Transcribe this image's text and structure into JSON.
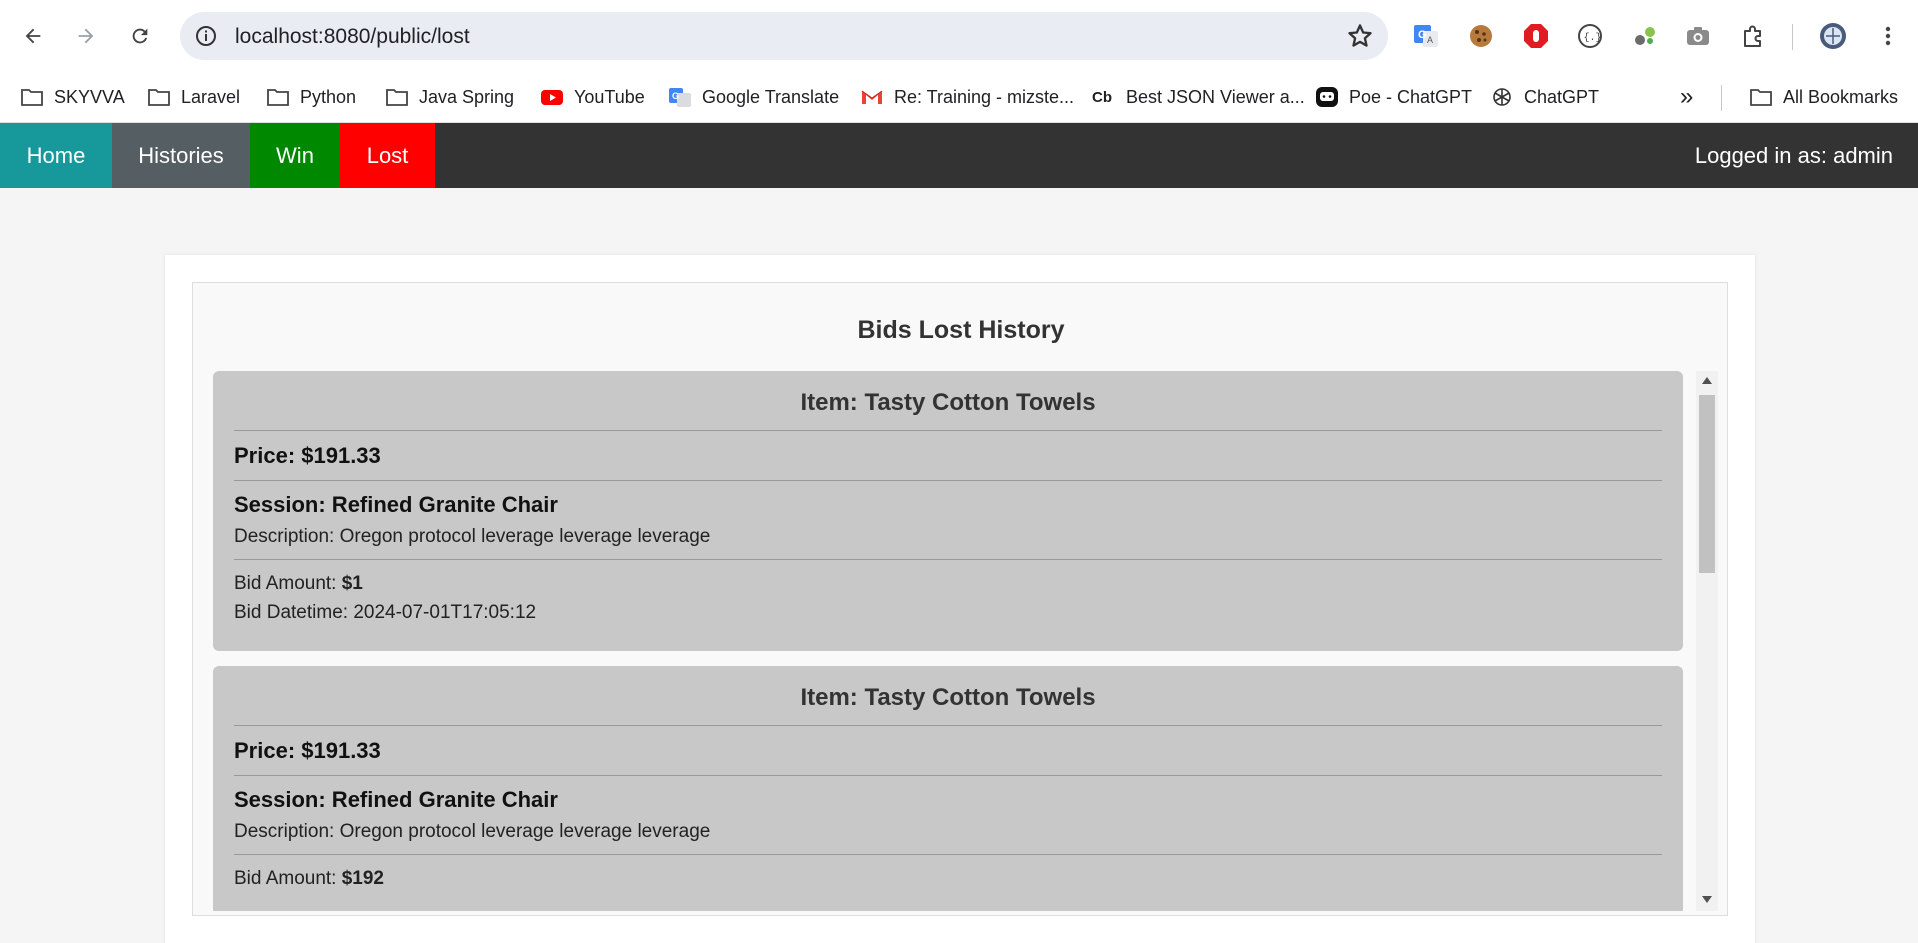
{
  "browser": {
    "url": "localhost:8080/public/lost",
    "bookmarks": [
      {
        "label": "SKYVVA",
        "icon": "folder-icon"
      },
      {
        "label": "Laravel",
        "icon": "folder-icon"
      },
      {
        "label": "Python",
        "icon": "folder-icon"
      },
      {
        "label": "Java Spring",
        "icon": "folder-icon"
      },
      {
        "label": "YouTube",
        "icon": "youtube-icon"
      },
      {
        "label": "Google Translate",
        "icon": "google-translate-icon"
      },
      {
        "label": "Re: Training - mizste...",
        "icon": "gmail-icon"
      },
      {
        "label": "Best JSON Viewer a...",
        "icon": "cb-icon"
      },
      {
        "label": "Poe - ChatGPT",
        "icon": "poe-icon"
      },
      {
        "label": "ChatGPT",
        "icon": "chatgpt-icon"
      }
    ],
    "cb_glyph": "Cb",
    "overflow_glyph": "»",
    "all_bookmarks": "All Bookmarks"
  },
  "nav": {
    "links": [
      {
        "label": "Home",
        "color": "#17999b"
      },
      {
        "label": "Histories",
        "color": "#555e62"
      },
      {
        "label": "Win",
        "color": "#008800"
      },
      {
        "label": "Lost",
        "color": "#ff0000"
      }
    ],
    "user_label": "Logged in as: admin",
    "bar_color": "#333333"
  },
  "page": {
    "heading": "Bids Lost History"
  },
  "bids": [
    {
      "item": "Item: Tasty Cotton Towels",
      "price": "Price: $191.33",
      "session": "Session: Refined Granite Chair",
      "description": "Description: Oregon protocol leverage leverage leverage",
      "amount_label": "Bid Amount: ",
      "amount_value": "$1",
      "datetime": "Bid Datetime: 2024-07-01T17:05:12"
    },
    {
      "item": "Item: Tasty Cotton Towels",
      "price": "Price: $191.33",
      "session": "Session: Refined Granite Chair",
      "description": "Description: Oregon protocol leverage leverage leverage",
      "amount_label": "Bid Amount: ",
      "amount_value": "$192",
      "datetime": ""
    }
  ]
}
